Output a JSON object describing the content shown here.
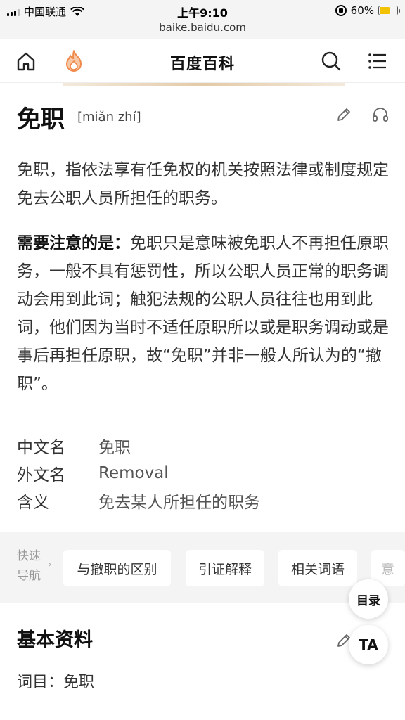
{
  "status_bar": {
    "carrier": "中国联通",
    "time": "上午9:10",
    "battery": "60%",
    "battery_level": 0.6,
    "url": "baike.baidu.com"
  },
  "header": {
    "title": "百度百科"
  },
  "entry": {
    "term": "免职",
    "pinyin": "[miǎn zhí]",
    "summary": "免职，指依法享有任免权的机关按照法律或制度规定免去公职人员所担任的职务。",
    "note_label": "需要注意的是：",
    "note_text": "免职只是意味被免职人不再担任原职务，一般不具有惩罚性，所以公职人员正常的职务调动会用到此词；触犯法规的公职人员往往也用到此词，他们因为当时不适任原职所以或是职务调动或是事后再担任原职，故“免职”并非一般人所认为的“撤职”。"
  },
  "info_table": [
    {
      "key": "中文名",
      "value": "免职"
    },
    {
      "key": "外文名",
      "value": "Removal"
    },
    {
      "key": "含义",
      "value": "免去某人所担任的职务"
    }
  ],
  "quick_nav": {
    "label_line1": "快速",
    "label_line2": "导航",
    "arrow": "›",
    "items": [
      "与撤职的区别",
      "引证解释",
      "相关词语",
      "意"
    ]
  },
  "basic_info": {
    "title": "基本资料",
    "entry_line": "词目：免职"
  },
  "floating": {
    "toc_label": "目录",
    "ta_label": "TA"
  },
  "colors": {
    "accent_orange": "#f08a4b",
    "battery_yellow": "#f2c200",
    "nav_background": "#f4f4f4"
  }
}
